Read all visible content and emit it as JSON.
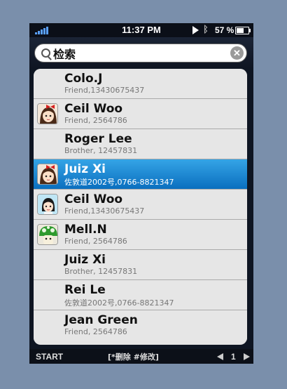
{
  "status_bar": {
    "time": "11:37 PM",
    "battery": "57 %"
  },
  "search": {
    "value": "检索",
    "placeholder": ""
  },
  "contacts": [
    {
      "name": "Colo.J",
      "detail": "Friend,13430675437",
      "avatar": "none"
    },
    {
      "name": "Ceil Woo",
      "detail": "Friend, 2564786",
      "avatar": "girl-red-bow-icon"
    },
    {
      "name": "Roger Lee",
      "detail": "Brother, 12457831",
      "avatar": "none"
    },
    {
      "name": "Juiz Xi",
      "detail": "佐敦道2002号,0766-8821347",
      "avatar": "girl-red-bow-icon",
      "selected": true
    },
    {
      "name": "Ceil Woo",
      "detail": "Friend,13430675437",
      "avatar": "girl-black-hair-icon"
    },
    {
      "name": "Mell.N",
      "detail": "Friend, 2564786",
      "avatar": "green-mushroom-icon"
    },
    {
      "name": "Juiz Xi",
      "detail": "Brother, 12457831",
      "avatar": "none"
    },
    {
      "name": "Rei Le",
      "detail": "佐敦道2002号,0766-8821347",
      "avatar": "none"
    },
    {
      "name": "Jean Green",
      "detail": "Friend, 2564786",
      "avatar": "none"
    }
  ],
  "bottom_bar": {
    "start": "START",
    "actions": "[*删除 #修改]",
    "page": "1"
  },
  "colors": {
    "selected_row": "#1a8ad6",
    "background": "#7a8fab"
  }
}
